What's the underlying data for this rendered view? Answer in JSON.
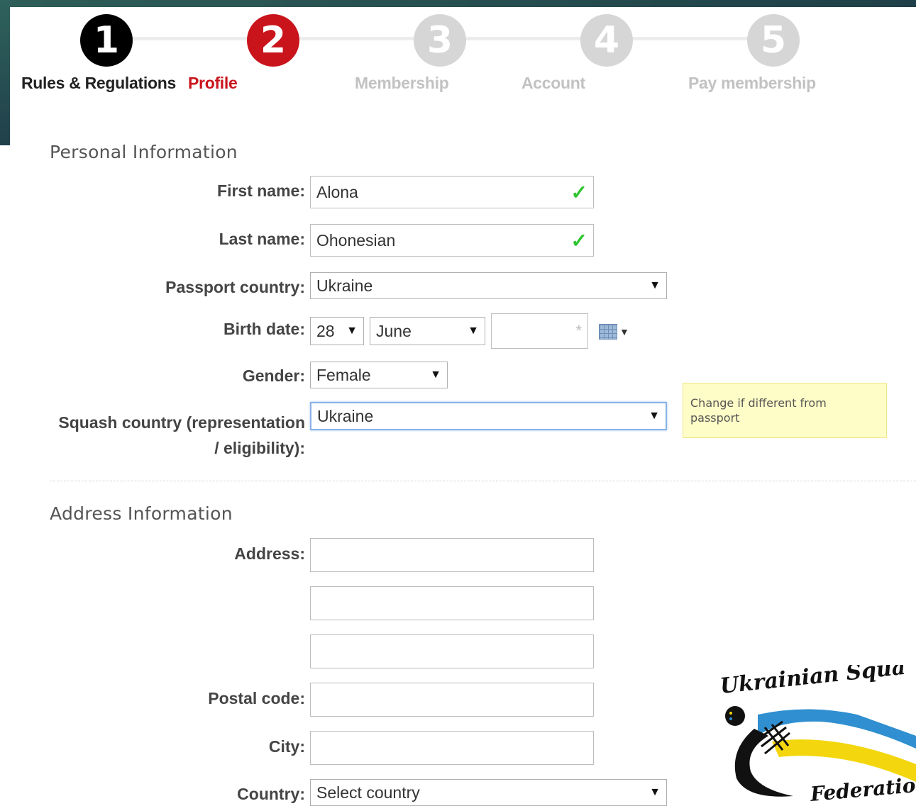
{
  "steps": [
    {
      "number": "1",
      "label": "Rules & Regulations",
      "state": "done"
    },
    {
      "number": "2",
      "label": "Profile",
      "state": "active"
    },
    {
      "number": "3",
      "label": "Membership",
      "state": "todo"
    },
    {
      "number": "4",
      "label": "Account",
      "state": "todo"
    },
    {
      "number": "5",
      "label": "Pay membership",
      "state": "todo"
    }
  ],
  "personal": {
    "title": "Personal Information",
    "first_name": {
      "label": "First name:",
      "value": "Alona"
    },
    "last_name": {
      "label": "Last name:",
      "value": "Ohonesian"
    },
    "passport_country": {
      "label": "Passport country:",
      "value": "Ukraine"
    },
    "birth_date": {
      "label": "Birth date:",
      "day": "28",
      "month": "June",
      "year": ""
    },
    "gender": {
      "label": "Gender:",
      "value": "Female"
    },
    "squash_country": {
      "label_line1": "Squash country (representation",
      "label_line2": "/ eligibility):",
      "value": "Ukraine"
    },
    "tooltip": "Change if different from passport"
  },
  "address": {
    "title": "Address Information",
    "address_label": "Address:",
    "line1": "",
    "line2": "",
    "line3": "",
    "postal_code": {
      "label": "Postal code:",
      "value": ""
    },
    "city": {
      "label": "City:",
      "value": ""
    },
    "country": {
      "label": "Country:",
      "value": "Select country"
    }
  },
  "logo": {
    "line1": "Ukrainian Squa",
    "line2": "Federatio"
  },
  "colors": {
    "accent": "#c9141c",
    "done": "#000000",
    "todo": "#d6d6d6",
    "valid": "#2ec52e"
  }
}
